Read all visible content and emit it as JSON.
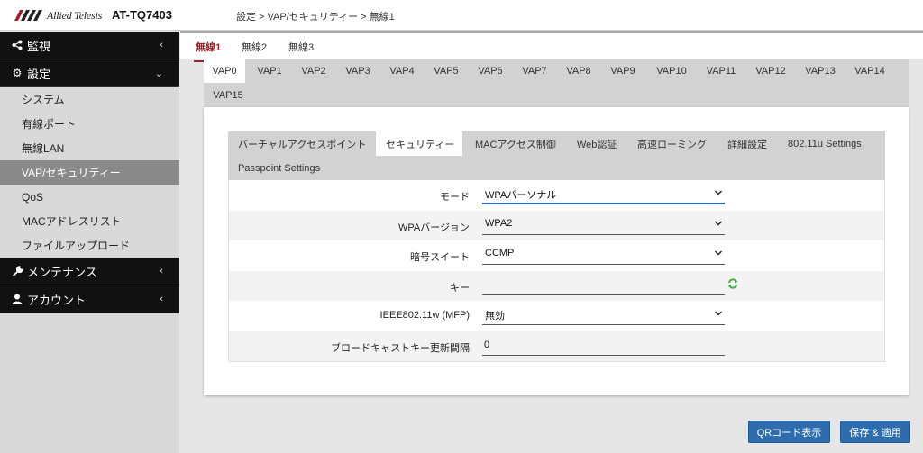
{
  "header": {
    "brand": "Allied Telesis",
    "model": "AT-TQ7403",
    "breadcrumb": "設定 > VAP/セキュリティー > 無線1"
  },
  "sidebar": {
    "monitor": {
      "label": "監視",
      "icon": "share-icon"
    },
    "settings": {
      "label": "設定",
      "icon": "gear-icon"
    },
    "settings_items": [
      "システム",
      "有線ポート",
      "無線LAN",
      "VAP/セキュリティー",
      "QoS",
      "MACアドレスリスト",
      "ファイルアップロード"
    ],
    "active_item": "VAP/セキュリティー",
    "maintenance": {
      "label": "メンテナンス",
      "icon": "wrench-icon"
    },
    "account": {
      "label": "アカウント",
      "icon": "user-icon"
    }
  },
  "radio_tabs": [
    "無線1",
    "無線2",
    "無線3"
  ],
  "active_radio": "無線1",
  "vap_tabs": [
    "VAP0",
    "VAP1",
    "VAP2",
    "VAP3",
    "VAP4",
    "VAP5",
    "VAP6",
    "VAP7",
    "VAP8",
    "VAP9",
    "VAP10",
    "VAP11",
    "VAP12",
    "VAP13",
    "VAP14",
    "VAP15"
  ],
  "active_vap": "VAP0",
  "sub_tabs": [
    "バーチャルアクセスポイント",
    "セキュリティー",
    "MACアクセス制御",
    "Web認証",
    "高速ローミング",
    "詳細設定",
    "802.11u Settings",
    "Passpoint Settings"
  ],
  "active_sub": "セキュリティー",
  "form": {
    "mode": {
      "label": "モード",
      "value": "WPAパーソナル"
    },
    "wpa_version": {
      "label": "WPAバージョン",
      "value": "WPA2"
    },
    "cipher": {
      "label": "暗号スイート",
      "value": "CCMP"
    },
    "key": {
      "label": "キー",
      "value": ""
    },
    "mfp": {
      "label": "IEEE802.11w (MFP)",
      "value": "無効"
    },
    "broadcast_interval": {
      "label": "ブロードキャストキー更新間隔",
      "value": "0"
    }
  },
  "buttons": {
    "qr": "QRコード表示",
    "save": "保存 & 適用"
  },
  "colors": {
    "accent": "#a0232b",
    "button": "#2e6dad",
    "focus": "#2a6fb8",
    "refresh": "#4caf50"
  }
}
